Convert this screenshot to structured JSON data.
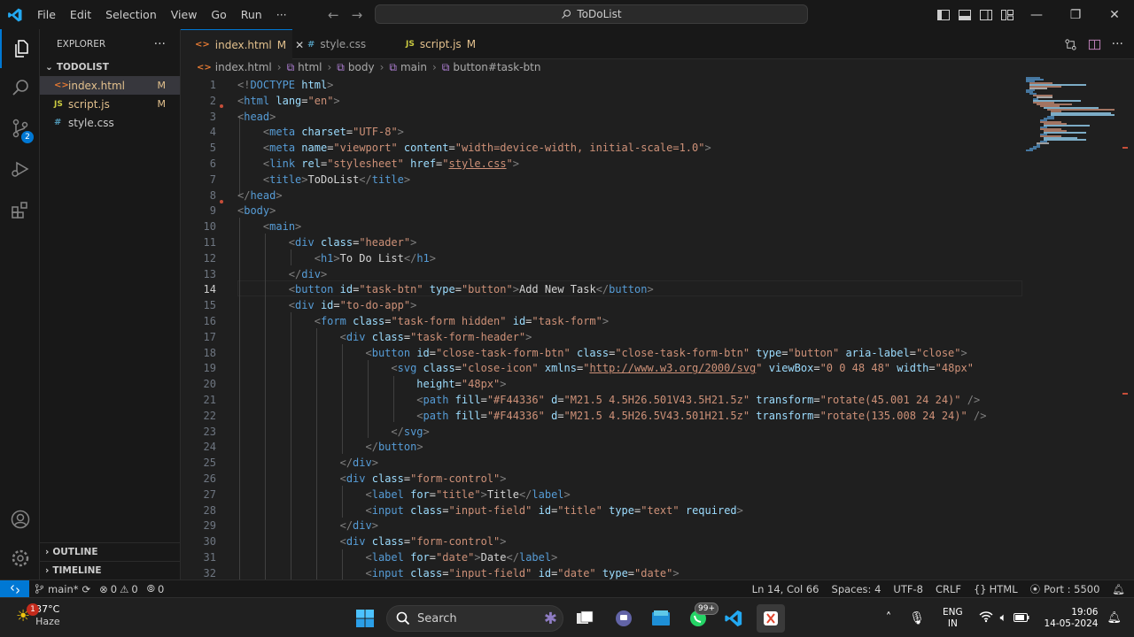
{
  "titlebar": {
    "menu": [
      "File",
      "Edit",
      "Selection",
      "View",
      "Go",
      "Run",
      "···"
    ],
    "command_center": "ToDoList",
    "accent": "#0078d4"
  },
  "activity": {
    "scm_badge": "2"
  },
  "sidebar": {
    "title": "EXPLORER",
    "more": "···",
    "root": "TODOLIST",
    "files": [
      {
        "icon": "<>",
        "name": "index.html",
        "status": "M"
      },
      {
        "icon": "JS",
        "name": "script.js",
        "status": "M"
      },
      {
        "icon": "#",
        "name": "style.css",
        "status": ""
      }
    ],
    "outline": "OUTLINE",
    "timeline": "TIMELINE"
  },
  "tabs": [
    {
      "icon": "<>",
      "name": "index.html",
      "status": "M",
      "close": "✕"
    },
    {
      "icon": "#",
      "name": "style.css",
      "status": ""
    },
    {
      "icon": "JS",
      "name": "script.js",
      "status": "M"
    }
  ],
  "breadcrumb": [
    "index.html",
    "html",
    "body",
    "main",
    "button#task-btn"
  ],
  "editor": {
    "current_line": 14,
    "line_numbers": [
      "1",
      "2",
      "3",
      "4",
      "5",
      "6",
      "7",
      "8",
      "9",
      "10",
      "11",
      "12",
      "13",
      "14",
      "15",
      "16",
      "17",
      "18",
      "19",
      "20",
      "21",
      "22",
      "23",
      "24",
      "25",
      "26",
      "27",
      "28",
      "29",
      "30",
      "31",
      "32"
    ]
  },
  "statusbar": {
    "branch": "main*",
    "errors": "0",
    "warnings": "0",
    "ports_count": "0",
    "position": "Ln 14, Col 66",
    "spaces": "Spaces: 4",
    "encoding": "UTF-8",
    "eol": "CRLF",
    "language": "HTML",
    "port": "Port : 5500"
  },
  "taskbar": {
    "weather_temp": "37°C",
    "weather_desc": "Haze",
    "weather_badge": "1",
    "search": "Search",
    "whatsapp_badge": "99+",
    "lang_line1": "ENG",
    "lang_line2": "IN",
    "time": "19:06",
    "date": "14-05-2024"
  }
}
